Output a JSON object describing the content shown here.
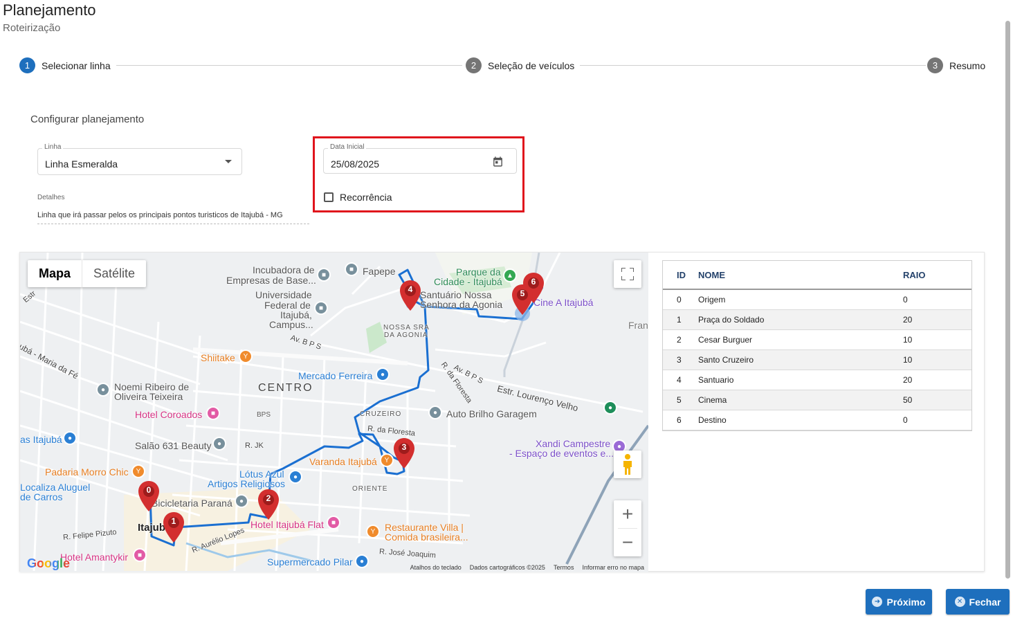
{
  "header": {
    "title": "Planejamento",
    "subtitle": "Roteirização"
  },
  "stepper": {
    "steps": [
      {
        "num": "1",
        "label": "Selecionar linha",
        "color": "#1e6fbd"
      },
      {
        "num": "2",
        "label": "Seleção de veículos",
        "color": "#757575"
      },
      {
        "num": "3",
        "label": "Resumo",
        "color": "#757575"
      }
    ]
  },
  "form": {
    "section_title": "Configurar planejamento",
    "linha": {
      "label": "Linha",
      "value": "Linha Esmeralda"
    },
    "data_inicial": {
      "label": "Data Inicial",
      "value": "25/08/2025"
    },
    "recorrencia": {
      "label": "Recorrência",
      "checked": false
    },
    "detalhes": {
      "label": "Detalhes",
      "value": "Linha que irá passar pelos os principais pontos turisticos de Itajubá - MG"
    }
  },
  "map": {
    "type_buttons": [
      "Mapa",
      "Satélite"
    ],
    "active_type": "Mapa",
    "fullscreen_icon": "fullscreen-icon",
    "pegman_icon": "pegman-icon",
    "zoom_in": "+",
    "zoom_out": "−",
    "labels": {
      "incubadora": "Incubadora de",
      "incubadora2": "Empresas de Base...",
      "fapepe": "Fapepe",
      "parque": "Parque da",
      "parque2": "Cidade - Itajubá",
      "universidade": "Universidade",
      "universidade2": "Federal de",
      "universidade3": "Itajubá,",
      "universidade4": "Campus...",
      "santuario": "Santuário Nossa",
      "santuario2": "Senhora da Agonia",
      "cine": "Cine A Itajubá",
      "nossa_sra": "NOSSA SRA",
      "nossa_sra2": "DA AGONIA",
      "fran": "Fran",
      "av_bps": "Av. B P S",
      "shiitake": "Shiitake",
      "mercado": "Mercado Ferreira",
      "centro": "CENTRO",
      "r_floresta": "R. da Floresta",
      "av_bps2": "Av. B P S",
      "estr_lorenco": "Estr. Lourenço Velho",
      "noemi": "Noemi Ribeiro de",
      "noemi2": "Oliveira Teixeira",
      "hotel_coroados": "Hotel Coroados",
      "bps": "BPS",
      "cruzeiro": "CRUZEIRO",
      "auto_brilho": "Auto Brilho Garagem",
      "itajuba_left": "as Itajubá",
      "salao": "Salão 631 Beauty",
      "r_jk": "R. JK",
      "r_floresta2": "R. da Floresta",
      "xandi": "Xandi Campestre",
      "xandi2": "- Espaço de eventos e...",
      "varanda": "Varanda Itajubá",
      "padaria": "Padaria Morro Chic",
      "lotus": "Lótus Azul",
      "artigos": "Artigos Religiosos",
      "localiza": "Localiza Aluguel",
      "localiza2": "de Carros",
      "oriente": "ORIENTE",
      "bicicletaria": "Bicicletaria Paraná",
      "hotel_flat": "Hotel Itajubá Flat",
      "itajuba": "Itajubá",
      "restaurante": "Restaurante Villa |",
      "restaurante2": "Comida brasileira...",
      "felipe": "R. Felipe Pizuto",
      "aurelio": "R. Aurélio Lopes",
      "jose": "R. José Joaquim",
      "amantykir": "Hotel Amantykir",
      "pilar": "Supermercado Pilar",
      "maria_fe": "ubá - Maria da Fé",
      "estr_top": "Estr"
    },
    "attribution": [
      "Atalhos do teclado",
      "Dados cartográficos ©2025",
      "Termos",
      "Informar erro no mapa"
    ],
    "google": "Google",
    "marker_labels": [
      "0",
      "1",
      "2",
      "3",
      "4",
      "5",
      "6"
    ],
    "route_color": "#1a6fd1",
    "marker_color": "#d32f2f"
  },
  "points_table": {
    "headers": [
      "ID",
      "NOME",
      "RAIO"
    ],
    "rows": [
      [
        "0",
        "Origem",
        "0"
      ],
      [
        "1",
        "Praça do Soldado",
        "20"
      ],
      [
        "2",
        "Cesar Burguer",
        "10"
      ],
      [
        "3",
        "Santo Cruzeiro",
        "10"
      ],
      [
        "4",
        "Santuario",
        "20"
      ],
      [
        "5",
        "Cinema",
        "50"
      ],
      [
        "6",
        "Destino",
        "0"
      ]
    ]
  },
  "actions": {
    "next": "Próximo",
    "close": "Fechar"
  }
}
